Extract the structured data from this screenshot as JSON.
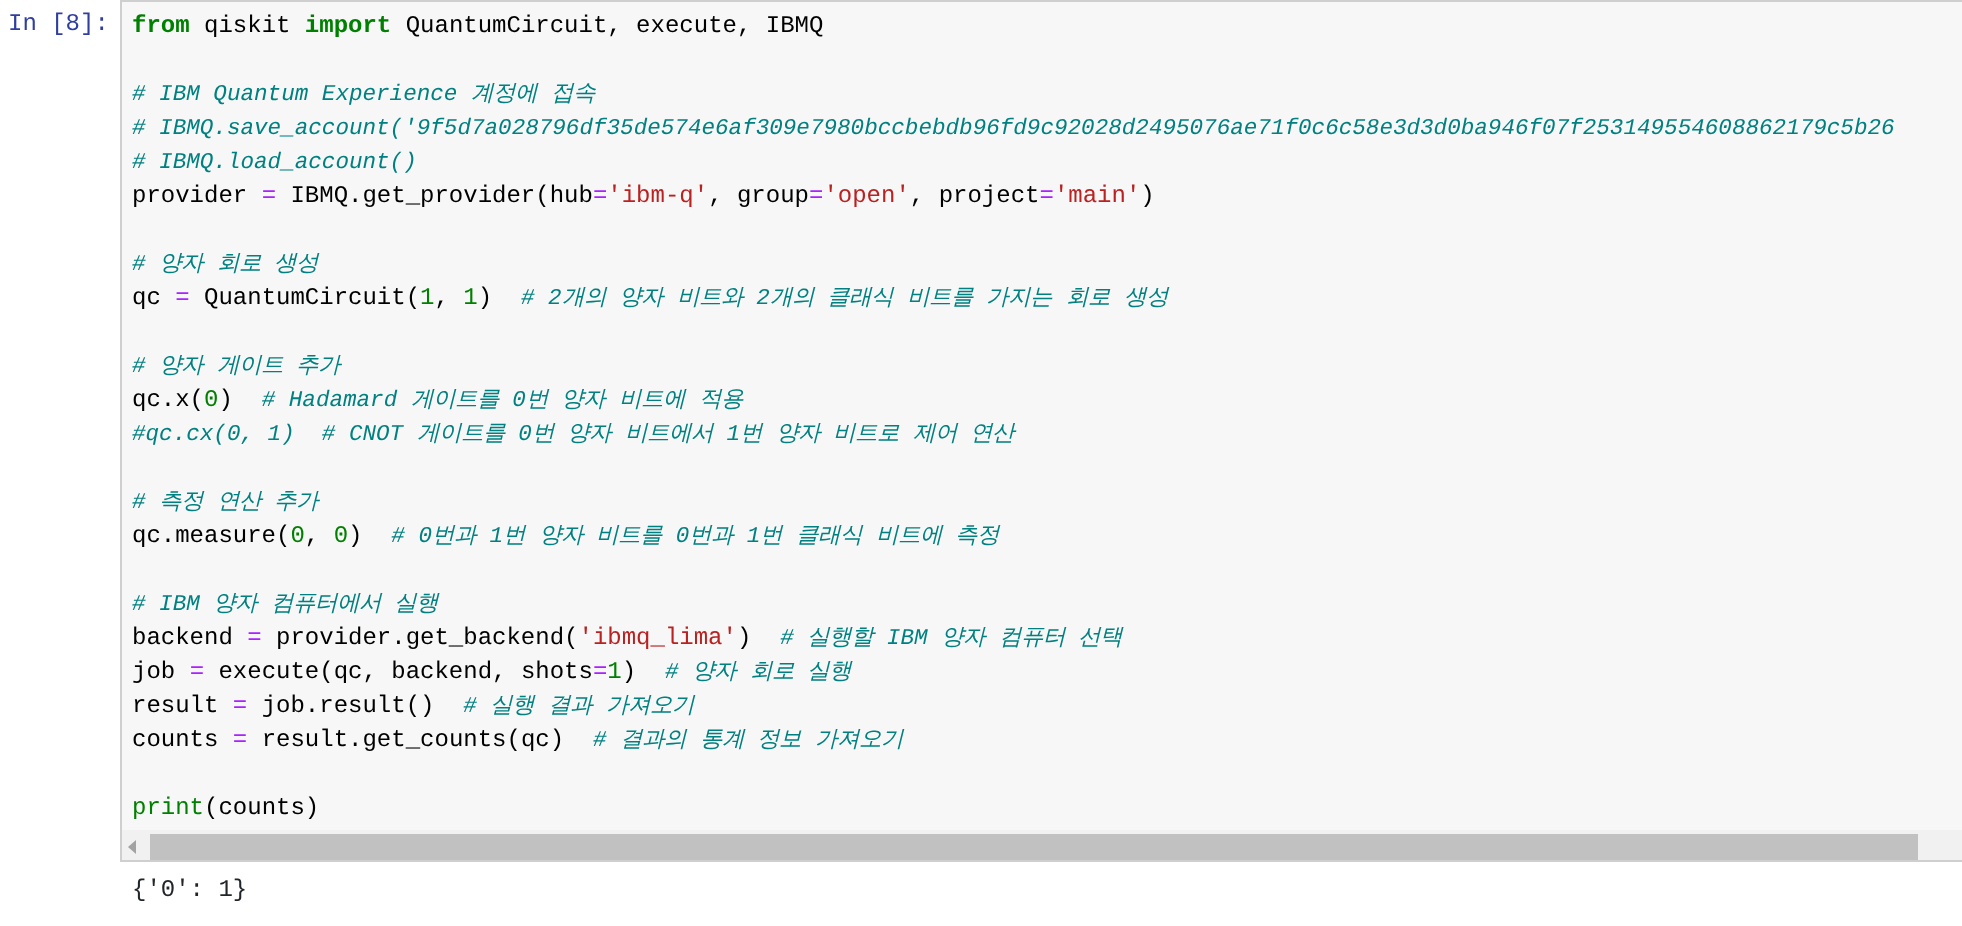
{
  "cell": {
    "prompt": "In [8]:",
    "lines": [
      {
        "kind": "code",
        "tokens": [
          {
            "kind": "keyword",
            "text": "from"
          },
          {
            "kind": "name",
            "text": " qiskit "
          },
          {
            "kind": "keyword",
            "text": "import"
          },
          {
            "kind": "name",
            "text": " QuantumCircuit, execute, IBMQ"
          }
        ]
      },
      {
        "kind": "blank"
      },
      {
        "kind": "code",
        "tokens": [
          {
            "kind": "comment",
            "text": "# IBM Quantum Experience 계정에 접속"
          }
        ]
      },
      {
        "kind": "code",
        "tokens": [
          {
            "kind": "comment",
            "text": "# IBMQ.save_account('9f5d7a028796df35de574e6af309e7980bccbebdb96fd9c92028d2495076ae71f0c6c58e3d3d0ba946f07f253149554608862179c5b26"
          }
        ]
      },
      {
        "kind": "code",
        "tokens": [
          {
            "kind": "comment",
            "text": "# IBMQ.load_account()"
          }
        ]
      },
      {
        "kind": "code",
        "tokens": [
          {
            "kind": "name",
            "text": "provider "
          },
          {
            "kind": "operator",
            "text": "="
          },
          {
            "kind": "name",
            "text": " IBMQ.get_provider(hub"
          },
          {
            "kind": "operator",
            "text": "="
          },
          {
            "kind": "string",
            "text": "'ibm-q'"
          },
          {
            "kind": "name",
            "text": ", group"
          },
          {
            "kind": "operator",
            "text": "="
          },
          {
            "kind": "string",
            "text": "'open'"
          },
          {
            "kind": "name",
            "text": ", project"
          },
          {
            "kind": "operator",
            "text": "="
          },
          {
            "kind": "string",
            "text": "'main'"
          },
          {
            "kind": "name",
            "text": ")"
          }
        ]
      },
      {
        "kind": "blank"
      },
      {
        "kind": "code",
        "tokens": [
          {
            "kind": "comment",
            "text": "# 양자 회로 생성"
          }
        ]
      },
      {
        "kind": "code",
        "tokens": [
          {
            "kind": "name",
            "text": "qc "
          },
          {
            "kind": "operator",
            "text": "="
          },
          {
            "kind": "name",
            "text": " QuantumCircuit("
          },
          {
            "kind": "number",
            "text": "1"
          },
          {
            "kind": "name",
            "text": ", "
          },
          {
            "kind": "number",
            "text": "1"
          },
          {
            "kind": "name",
            "text": ")  "
          },
          {
            "kind": "comment",
            "text": "# 2개의 양자 비트와 2개의 클래식 비트를 가지는 회로 생성"
          }
        ]
      },
      {
        "kind": "blank"
      },
      {
        "kind": "code",
        "tokens": [
          {
            "kind": "comment",
            "text": "# 양자 게이트 추가"
          }
        ]
      },
      {
        "kind": "code",
        "tokens": [
          {
            "kind": "name",
            "text": "qc.x("
          },
          {
            "kind": "number",
            "text": "0"
          },
          {
            "kind": "name",
            "text": ")  "
          },
          {
            "kind": "comment",
            "text": "# Hadamard 게이트를 0번 양자 비트에 적용"
          }
        ]
      },
      {
        "kind": "code",
        "tokens": [
          {
            "kind": "comment",
            "text": "#qc.cx(0, 1)  # CNOT 게이트를 0번 양자 비트에서 1번 양자 비트로 제어 연산"
          }
        ]
      },
      {
        "kind": "blank"
      },
      {
        "kind": "code",
        "tokens": [
          {
            "kind": "comment",
            "text": "# 측정 연산 추가"
          }
        ]
      },
      {
        "kind": "code",
        "tokens": [
          {
            "kind": "name",
            "text": "qc.measure("
          },
          {
            "kind": "number",
            "text": "0"
          },
          {
            "kind": "name",
            "text": ", "
          },
          {
            "kind": "number",
            "text": "0"
          },
          {
            "kind": "name",
            "text": ")  "
          },
          {
            "kind": "comment",
            "text": "# 0번과 1번 양자 비트를 0번과 1번 클래식 비트에 측정"
          }
        ]
      },
      {
        "kind": "blank"
      },
      {
        "kind": "code",
        "tokens": [
          {
            "kind": "comment",
            "text": "# IBM 양자 컴퓨터에서 실행"
          }
        ]
      },
      {
        "kind": "code",
        "tokens": [
          {
            "kind": "name",
            "text": "backend "
          },
          {
            "kind": "operator",
            "text": "="
          },
          {
            "kind": "name",
            "text": " provider.get_backend("
          },
          {
            "kind": "string",
            "text": "'ibmq_lima'"
          },
          {
            "kind": "name",
            "text": ")  "
          },
          {
            "kind": "comment",
            "text": "# 실행할 IBM 양자 컴퓨터 선택"
          }
        ]
      },
      {
        "kind": "code",
        "tokens": [
          {
            "kind": "name",
            "text": "job "
          },
          {
            "kind": "operator",
            "text": "="
          },
          {
            "kind": "name",
            "text": " execute(qc, backend, shots"
          },
          {
            "kind": "operator",
            "text": "="
          },
          {
            "kind": "number",
            "text": "1"
          },
          {
            "kind": "name",
            "text": ")  "
          },
          {
            "kind": "comment",
            "text": "# 양자 회로 실행"
          }
        ]
      },
      {
        "kind": "code",
        "tokens": [
          {
            "kind": "name",
            "text": "result "
          },
          {
            "kind": "operator",
            "text": "="
          },
          {
            "kind": "name",
            "text": " job.result()  "
          },
          {
            "kind": "comment",
            "text": "# 실행 결과 가져오기"
          }
        ]
      },
      {
        "kind": "code",
        "tokens": [
          {
            "kind": "name",
            "text": "counts "
          },
          {
            "kind": "operator",
            "text": "="
          },
          {
            "kind": "name",
            "text": " result.get_counts(qc)  "
          },
          {
            "kind": "comment",
            "text": "# 결과의 통계 정보 가져오기"
          }
        ]
      },
      {
        "kind": "blank"
      },
      {
        "kind": "code",
        "tokens": [
          {
            "kind": "builtin",
            "text": "print"
          },
          {
            "kind": "name",
            "text": "(counts)"
          }
        ]
      }
    ],
    "output": "{'0': 1}"
  }
}
